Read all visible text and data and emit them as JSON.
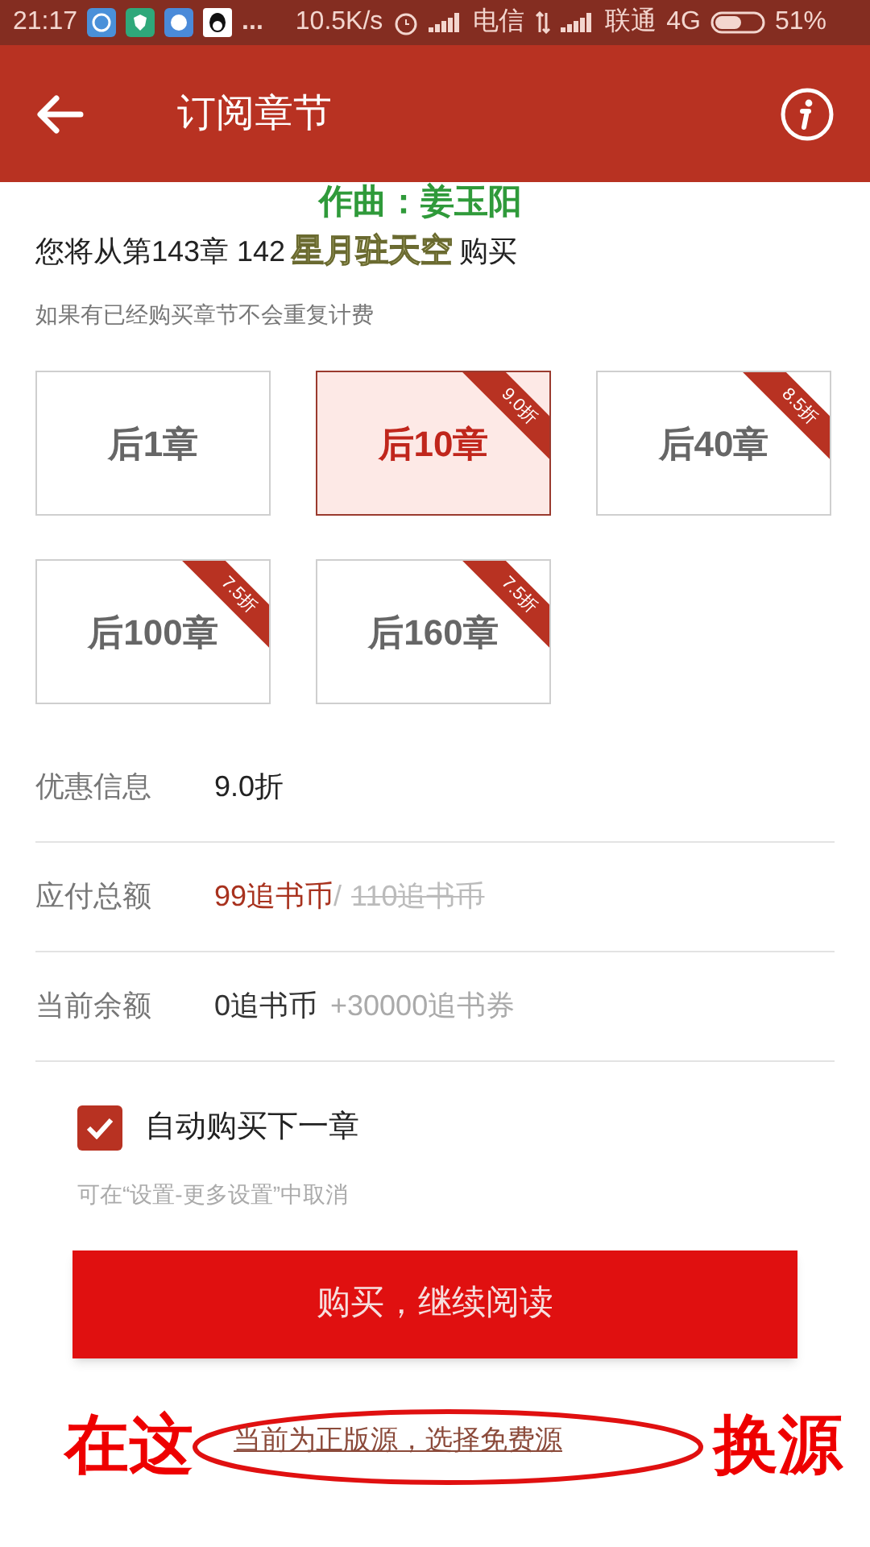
{
  "status_bar": {
    "time": "21:17",
    "more": "...",
    "speed": "10.5K/s",
    "carrier_1": "电信",
    "carrier_2": "联通",
    "network": "4G",
    "battery": "51%"
  },
  "header": {
    "title": "订阅章节"
  },
  "overlay_subtitles": [
    "作曲：姜玉阳",
    "星月驻天空"
  ],
  "notice": {
    "text_before": "您将从第143章 142",
    "text_after": "购买",
    "hint": "如果有已经购买章节不会重复计费"
  },
  "options": [
    {
      "label": "后1章",
      "selected": false
    },
    {
      "label": "后10章",
      "discount": "9.0折",
      "selected": true
    },
    {
      "label": "后40章",
      "discount": "8.5折",
      "selected": false
    },
    {
      "label": "后100章",
      "discount": "7.5折",
      "selected": false
    },
    {
      "label": "后160章",
      "discount": "7.5折",
      "selected": false
    }
  ],
  "info_rows": [
    {
      "kind": "discount",
      "label": "优惠信息",
      "value": "9.0折"
    },
    {
      "kind": "total",
      "label": "应付总额",
      "price": "99追书币",
      "separator": "/",
      "original_price": "110追书币"
    },
    {
      "kind": "balance",
      "label": "当前余额",
      "value": "0追书币",
      "bonus": "+30000追书券"
    }
  ],
  "auto_buy": {
    "label": "自动购买下一章",
    "checked": true,
    "hint": "可在“设置-更多设置”中取消"
  },
  "buy_button": "购买，继续阅读",
  "source_link": "当前为正版源，选择免费源",
  "annotations": {
    "left": "在这",
    "right": "换源"
  }
}
